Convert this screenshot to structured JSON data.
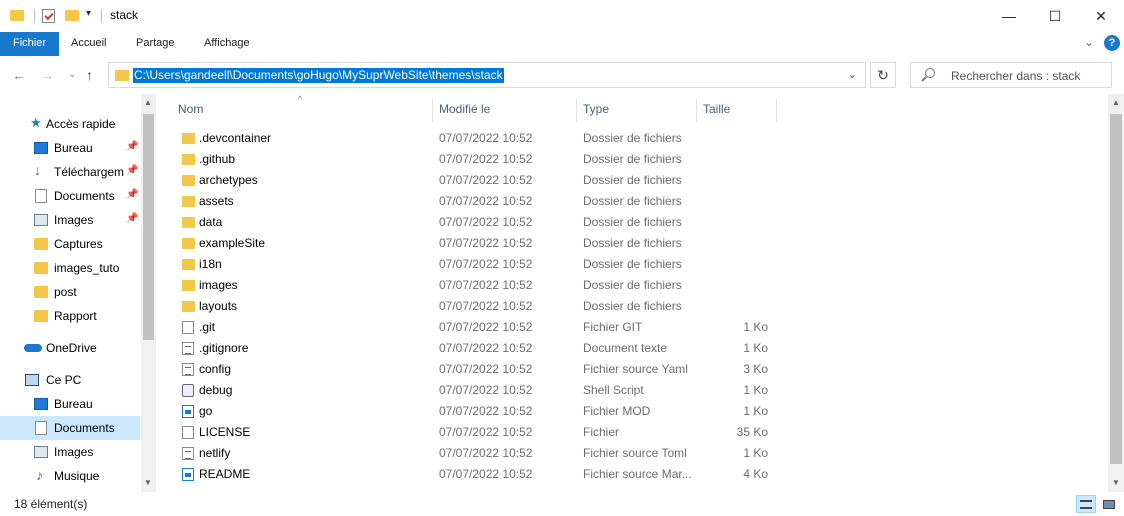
{
  "window": {
    "title": "stack",
    "minimize": "—",
    "maximize": "☐",
    "close": "✕"
  },
  "ribbon": {
    "tabs": [
      "Fichier",
      "Accueil",
      "Partage",
      "Affichage"
    ],
    "help": "?"
  },
  "address": {
    "path": "C:\\Users\\gandeell\\Documents\\goHugo\\MySuprWebSite\\themes\\stack",
    "search_placeholder": "Rechercher dans : stack"
  },
  "nav": {
    "items": [
      {
        "label": "Accès rapide",
        "icon": "star-icon"
      },
      {
        "label": "Bureau",
        "icon": "desktop-icon",
        "pinned": true
      },
      {
        "label": "Téléchargements",
        "icon": "download-icon",
        "pinned": true
      },
      {
        "label": "Documents",
        "icon": "documents-icon",
        "pinned": true
      },
      {
        "label": "Images",
        "icon": "images-icon",
        "pinned": true
      },
      {
        "label": "Captures",
        "icon": "folder-icon"
      },
      {
        "label": "images_tuto",
        "icon": "folder-icon"
      },
      {
        "label": "post",
        "icon": "folder-icon"
      },
      {
        "label": "Rapport",
        "icon": "folder-icon"
      },
      {
        "label": "OneDrive",
        "icon": "onedrive-icon"
      },
      {
        "label": "Ce PC",
        "icon": "pc-icon"
      },
      {
        "label": "Bureau",
        "icon": "desktop-icon"
      },
      {
        "label": "Documents",
        "icon": "documents-icon",
        "selected": true
      },
      {
        "label": "Images",
        "icon": "images-icon"
      },
      {
        "label": "Musique",
        "icon": "music-icon"
      }
    ]
  },
  "columns": {
    "name": "Nom",
    "modified": "Modifié le",
    "type": "Type",
    "size": "Taille"
  },
  "files": [
    {
      "name": ".devcontainer",
      "date": "07/07/2022 10:52",
      "type": "Dossier de fichiers",
      "size": "",
      "kind": "folder"
    },
    {
      "name": ".github",
      "date": "07/07/2022 10:52",
      "type": "Dossier de fichiers",
      "size": "",
      "kind": "folder"
    },
    {
      "name": "archetypes",
      "date": "07/07/2022 10:52",
      "type": "Dossier de fichiers",
      "size": "",
      "kind": "folder"
    },
    {
      "name": "assets",
      "date": "07/07/2022 10:52",
      "type": "Dossier de fichiers",
      "size": "",
      "kind": "folder"
    },
    {
      "name": "data",
      "date": "07/07/2022 10:52",
      "type": "Dossier de fichiers",
      "size": "",
      "kind": "folder"
    },
    {
      "name": "exampleSite",
      "date": "07/07/2022 10:52",
      "type": "Dossier de fichiers",
      "size": "",
      "kind": "folder"
    },
    {
      "name": "i18n",
      "date": "07/07/2022 10:52",
      "type": "Dossier de fichiers",
      "size": "",
      "kind": "folder"
    },
    {
      "name": "images",
      "date": "07/07/2022 10:52",
      "type": "Dossier de fichiers",
      "size": "",
      "kind": "folder"
    },
    {
      "name": "layouts",
      "date": "07/07/2022 10:52",
      "type": "Dossier de fichiers",
      "size": "",
      "kind": "folder"
    },
    {
      "name": ".git",
      "date": "07/07/2022 10:52",
      "type": "Fichier GIT",
      "size": "1 Ko",
      "kind": "file"
    },
    {
      "name": ".gitignore",
      "date": "07/07/2022 10:52",
      "type": "Document texte",
      "size": "1 Ko",
      "kind": "text"
    },
    {
      "name": "config",
      "date": "07/07/2022 10:52",
      "type": "Fichier source Yaml",
      "size": "3 Ko",
      "kind": "text"
    },
    {
      "name": "debug",
      "date": "07/07/2022 10:52",
      "type": "Shell Script",
      "size": "1 Ko",
      "kind": "script"
    },
    {
      "name": "go",
      "date": "07/07/2022 10:52",
      "type": "Fichier MOD",
      "size": "1 Ko",
      "kind": "gomod"
    },
    {
      "name": "LICENSE",
      "date": "07/07/2022 10:52",
      "type": "Fichier",
      "size": "35 Ko",
      "kind": "file"
    },
    {
      "name": "netlify",
      "date": "07/07/2022 10:52",
      "type": "Fichier source Toml",
      "size": "1 Ko",
      "kind": "text"
    },
    {
      "name": "README",
      "date": "07/07/2022 10:52",
      "type": "Fichier source Mar...",
      "size": "4 Ko",
      "kind": "gomod"
    }
  ],
  "status": {
    "count": "18 élément(s)"
  }
}
